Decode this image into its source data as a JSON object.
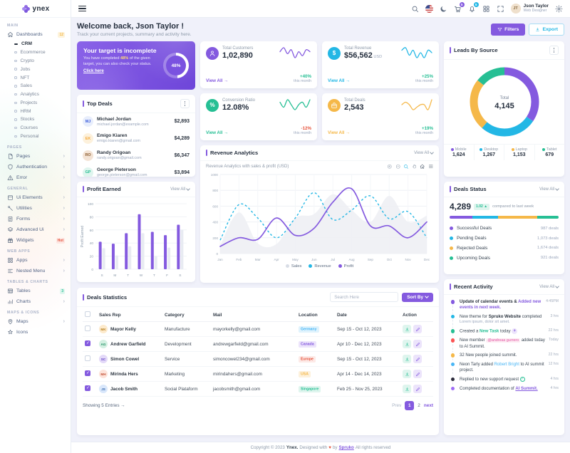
{
  "app": {
    "name": "ynex"
  },
  "theme": {
    "primary": "#845adf",
    "secondary": "#23b7e5",
    "success": "#26bf94",
    "warning": "#f5b849",
    "danger": "#e6533c",
    "info": "#49b6f5",
    "muted_area": "#eef0f4",
    "grid": "#eef1f5"
  },
  "header": {
    "user_name": "Json Taylor",
    "user_role": "Web Designer",
    "user_initials": "JT",
    "cart_badge": "5",
    "bell_badge": "5"
  },
  "sidebar": {
    "sections": [
      {
        "caption": "MAIN",
        "items": [
          {
            "label": "Dashboards",
            "icon": "home",
            "badge": "12",
            "badge_color": "warning",
            "children": [
              {
                "label": "CRM",
                "active": true
              },
              {
                "label": "Ecommerce"
              },
              {
                "label": "Crypto"
              },
              {
                "label": "Jobs"
              },
              {
                "label": "NFT"
              },
              {
                "label": "Sales"
              },
              {
                "label": "Analytics"
              },
              {
                "label": "Projects"
              },
              {
                "label": "HRM"
              },
              {
                "label": "Stocks"
              },
              {
                "label": "Courses"
              },
              {
                "label": "Personal"
              }
            ]
          }
        ]
      },
      {
        "caption": "PAGES",
        "items": [
          {
            "label": "Pages",
            "icon": "file",
            "arrow": true
          },
          {
            "label": "Authentication",
            "icon": "shield",
            "arrow": true
          },
          {
            "label": "Error",
            "icon": "warn",
            "arrow": true
          }
        ]
      },
      {
        "caption": "GENERAL",
        "items": [
          {
            "label": "Ui Elements",
            "icon": "uibox",
            "arrow": true
          },
          {
            "label": "Utilities",
            "icon": "wrench",
            "arrow": true
          },
          {
            "label": "Forms",
            "icon": "forms",
            "arrow": true
          },
          {
            "label": "Advanced Ui",
            "icon": "layers",
            "arrow": true
          },
          {
            "label": "Widgets",
            "icon": "gift",
            "badge": "Hot",
            "badge_color": "danger"
          }
        ]
      },
      {
        "caption": "WEB APPS",
        "items": [
          {
            "label": "Apps",
            "icon": "apps",
            "arrow": true
          },
          {
            "label": "Nested Menu",
            "icon": "nested",
            "arrow": true
          }
        ]
      },
      {
        "caption": "TABLES & CHARTS",
        "items": [
          {
            "label": "Tables",
            "icon": "table",
            "badge": "3",
            "badge_color": "success"
          },
          {
            "label": "Charts",
            "icon": "chart",
            "arrow": true
          }
        ]
      },
      {
        "caption": "MAPS & ICONS",
        "items": [
          {
            "label": "Maps",
            "icon": "pin",
            "arrow": true
          },
          {
            "label": "Icons",
            "icon": "star"
          }
        ]
      }
    ]
  },
  "welcome": {
    "title": "Welcome back, Json Taylor !",
    "subtitle": "Track your current projects, summary and activity here.",
    "filters_label": "Filters",
    "export_label": "Export"
  },
  "banner": {
    "title": "Your target is incomplete",
    "body_prefix": "You have completed ",
    "body_highlight": "48%",
    "body_suffix": " of the given target, you can also check your status.",
    "link": "Click here",
    "progress_pct": 48,
    "progress_label": "48%"
  },
  "stats": [
    {
      "label": "Total Customers",
      "value": "1,02,890",
      "unit": "",
      "view_all": "View All",
      "arrow": "→",
      "change": "+40%",
      "change_dir": "up",
      "period": "this month",
      "color": "#845adf",
      "icon": "person",
      "spark": [
        6,
        8,
        5,
        7,
        3,
        6,
        4,
        7,
        6
      ]
    },
    {
      "label": "Total Revenue",
      "value": "$56,562",
      "unit": "USD",
      "view_all": "View All",
      "arrow": "→",
      "change": "+25%",
      "change_dir": "up",
      "period": "this month",
      "color": "#23b7e5",
      "icon": "$",
      "spark": [
        6,
        7,
        4,
        6,
        3,
        5,
        3,
        6,
        5
      ]
    },
    {
      "label": "Conversion Ratio",
      "value": "12.08%",
      "unit": "",
      "view_all": "View All",
      "arrow": "→",
      "change": "-12%",
      "change_dir": "down",
      "period": "this month",
      "color": "#26bf94",
      "icon": "%",
      "spark": [
        6,
        4,
        7,
        5,
        3,
        5,
        6,
        4,
        7
      ]
    },
    {
      "label": "Total Deals",
      "value": "2,543",
      "unit": "",
      "view_all": "View All",
      "arrow": "→",
      "change": "+19%",
      "change_dir": "up",
      "period": "this month",
      "color": "#f5b849",
      "icon": "case",
      "spark": [
        5,
        6,
        5,
        3,
        4,
        5,
        5,
        3,
        7
      ]
    }
  ],
  "top_deals": {
    "title": "Top Deals",
    "items": [
      {
        "name": "Michael Jordan",
        "email": "michael.jordan@example.com",
        "amount": "$2,893",
        "initials": "MJ",
        "av_bg": "#e8eefc",
        "av_fg": "#3b5bdb"
      },
      {
        "name": "Emigo Kiaren",
        "email": "emigo.kiaren@gmail.com",
        "amount": "$4,289",
        "initials": "EK",
        "av_bg": "#fdf1dc",
        "av_fg": "#f5a93b"
      },
      {
        "name": "Randy Origoan",
        "email": "randy.origoan@gmail.com",
        "amount": "$6,347",
        "initials": "RO",
        "av_bg": "#f3e3d5",
        "av_fg": "#8a5a2b"
      },
      {
        "name": "George Pieterson",
        "email": "george.pieterson@gmail.com",
        "amount": "$3,894",
        "initials": "GP",
        "av_bg": "#dff5ee",
        "av_fg": "#26bf94"
      }
    ]
  },
  "profit_earned": {
    "title": "Profit Earned",
    "view_all": "View All",
    "chart": {
      "type": "bar",
      "categories": [
        "S",
        "M",
        "T",
        "W",
        "T",
        "F",
        "S"
      ],
      "ylabel": "Profit Earned",
      "ylim": [
        0,
        100
      ],
      "yticks": [
        0,
        20,
        40,
        60,
        80,
        100
      ],
      "series": [
        {
          "name": "Profit",
          "color": "#845adf",
          "values": [
            42,
            39,
            55,
            84,
            57,
            52,
            68
          ]
        },
        {
          "name": "Previous",
          "color": "#e8ebf2",
          "values": [
            32,
            21,
            35,
            55,
            20,
            33,
            60
          ]
        }
      ]
    }
  },
  "revenue_analytics": {
    "title": "Revenue Analytics",
    "view_all": "View All",
    "subtitle": "Revenue Analytics with sales & profit (USD)",
    "chart": {
      "type": "line",
      "x": [
        "Jan",
        "Feb",
        "Mar",
        "Apr",
        "May",
        "Jun",
        "Jul",
        "Aug",
        "Sep",
        "Oct",
        "Nov",
        "Dec"
      ],
      "ylim": [
        0,
        1000
      ],
      "yticks": [
        0,
        200,
        400,
        600,
        800,
        1000
      ],
      "series": [
        {
          "name": "Sales",
          "style": "area",
          "color": "#eef0f4",
          "values": [
            100,
            520,
            130,
            120,
            450,
            500,
            750,
            550,
            400,
            730,
            400,
            480
          ]
        },
        {
          "name": "Revenue",
          "style": "dashed",
          "color": "#23b7e5",
          "values": [
            170,
            620,
            450,
            200,
            450,
            770,
            430,
            550,
            730,
            440,
            530,
            200
          ]
        },
        {
          "name": "Profit",
          "style": "solid",
          "color": "#845adf",
          "values": [
            90,
            200,
            180,
            450,
            230,
            320,
            650,
            820,
            350,
            350,
            200,
            400
          ]
        }
      ],
      "legend": [
        "Sales",
        "Revenue",
        "Profit"
      ],
      "legend_colors": [
        "#d8dde6",
        "#23b7e5",
        "#845adf"
      ]
    }
  },
  "leads": {
    "title": "Leads By Source",
    "total_label": "Total",
    "total_value": "4,145",
    "segments": [
      {
        "label": "Mobile",
        "value": "1,624",
        "num": 1624,
        "color": "#845adf"
      },
      {
        "label": "Desktop",
        "value": "1,267",
        "num": 1267,
        "color": "#23b7e5"
      },
      {
        "label": "Laptop",
        "value": "1,153",
        "num": 1153,
        "color": "#f5b849"
      },
      {
        "label": "Tablet",
        "value": "679",
        "num": 679,
        "color": "#26bf94"
      }
    ]
  },
  "deals_status": {
    "title": "Deals Status",
    "view_all": "View All",
    "value": "4,289",
    "badge": "1.02 ▲",
    "compare_text": "compared to last week",
    "items": [
      {
        "label": "Successful Deals",
        "count": "987 deals",
        "num": 987,
        "color": "#845adf"
      },
      {
        "label": "Pending Deals",
        "count": "1,073 deals",
        "num": 1073,
        "color": "#23b7e5"
      },
      {
        "label": "Rejected Deals",
        "count": "1,674 deals",
        "num": 1674,
        "color": "#f5b849"
      },
      {
        "label": "Upcoming Deals",
        "count": "921 deals",
        "num": 921,
        "color": "#26bf94"
      }
    ]
  },
  "recent_activity": {
    "title": "Recent Activity",
    "view_all": "View All",
    "items": [
      {
        "dot": "#845adf",
        "time": "4:45PM",
        "segments": [
          {
            "t": "Update of calendar events & ",
            "b": true
          },
          {
            "t": "Added new events in next week.",
            "color": "primary"
          }
        ]
      },
      {
        "dot": "#23b7e5",
        "time": "3 hrs",
        "segments": [
          {
            "t": "New theme for "
          },
          {
            "t": "Spruko Website",
            "b": true
          },
          {
            "t": " completed"
          }
        ],
        "sub": "Lorem ipsum, dolor sit amet."
      },
      {
        "dot": "#26bf94",
        "time": "22 hrs",
        "segments": [
          {
            "t": "Created a "
          },
          {
            "t": "New Task",
            "color": "success"
          },
          {
            "t": " today "
          },
          {
            "chip": "+"
          }
        ]
      },
      {
        "dot": "#fb5454",
        "time": "Today",
        "segments": [
          {
            "t": "New member "
          },
          {
            "t": "@andreas gurrero",
            "pill": true
          },
          {
            "t": " added today to AI Summit."
          }
        ]
      },
      {
        "dot": "#f5b849",
        "time": "22 hrs",
        "segments": [
          {
            "t": "32 New people joined summit."
          }
        ]
      },
      {
        "dot": "#49b6f5",
        "time": "12 hrs",
        "segments": [
          {
            "t": "Neon Tarly added "
          },
          {
            "t": "Robert Bright",
            "color": "info"
          },
          {
            "t": " to AI summit project."
          }
        ]
      },
      {
        "dot": "#2b2b3b",
        "time": "4 hrs",
        "segments": [
          {
            "t": "Replied to new support request "
          },
          {
            "check": true
          }
        ]
      },
      {
        "dot": "#9e6cf5",
        "time": "4 hrs",
        "segments": [
          {
            "t": "Completed documentation of "
          },
          {
            "t": "AI Summit.",
            "color": "primary",
            "underline": true
          }
        ]
      }
    ]
  },
  "deals_table": {
    "title": "Deals Statistics",
    "search_placeholder": "Search Here",
    "sort_label": "Sort By",
    "columns": [
      "Sales Rep",
      "Category",
      "Mail",
      "Location",
      "Date",
      "Action"
    ],
    "rows": [
      {
        "checked": false,
        "name": "Mayor Kelly",
        "initials": "MK",
        "av_bg": "#fdeacc",
        "av_fg": "#b57f1f",
        "category": "Manufacture",
        "mail": "mayorkelly@gmail.com",
        "location": "Germany",
        "loc_bg": "#e0f3fd",
        "loc_fg": "#49b6f5",
        "date": "Sep 15 - Oct 12, 2023"
      },
      {
        "checked": true,
        "name": "Andrew Garfield",
        "initials": "AG",
        "av_bg": "#d4f0e2",
        "av_fg": "#1f8f63",
        "category": "Development",
        "mail": "andrewgarfield@gmail.com",
        "location": "Canada",
        "loc_bg": "#ece4fb",
        "loc_fg": "#845adf",
        "date": "Apr 10 - Dec 12, 2023"
      },
      {
        "checked": false,
        "name": "Simon Cowel",
        "initials": "SC",
        "av_bg": "#e3d9f8",
        "av_fg": "#5f3dc4",
        "category": "Service",
        "mail": "simoncowel234@gmail.com",
        "location": "Europe",
        "loc_bg": "#fdeae7",
        "loc_fg": "#e6533c",
        "date": "Sep 15 - Oct 12, 2023"
      },
      {
        "checked": true,
        "name": "Mirinda Hers",
        "initials": "MH",
        "av_bg": "#fde3da",
        "av_fg": "#c2543a",
        "category": "Marketing",
        "mail": "mirindahers@gmail.com",
        "location": "USA",
        "loc_bg": "#fdf1dc",
        "loc_fg": "#f5b849",
        "date": "Apr 14 - Dec 14, 2023"
      },
      {
        "checked": true,
        "name": "Jacob Smith",
        "initials": "JS",
        "av_bg": "#d9e7fb",
        "av_fg": "#3366aa",
        "category": "Social Plataform",
        "mail": "jacobsmith@gmail.com",
        "location": "Singapore",
        "loc_bg": "#dff5ee",
        "loc_fg": "#26bf94",
        "date": "Feb 25 - Nov 25, 2023"
      }
    ],
    "showing_text": "Showing 5 Entries",
    "showing_arrow": "→",
    "prev_label": "Prev",
    "pages": [
      "1",
      "2"
    ],
    "active_page": "1",
    "next_label": "next"
  },
  "footer": {
    "prefix": "Copyright © 2023 ",
    "brand": "Ynex.",
    "mid": " Designed with ",
    "heart": "♥",
    "by": " by ",
    "designer": "Spruko",
    "suffix": " All rights reserved"
  }
}
